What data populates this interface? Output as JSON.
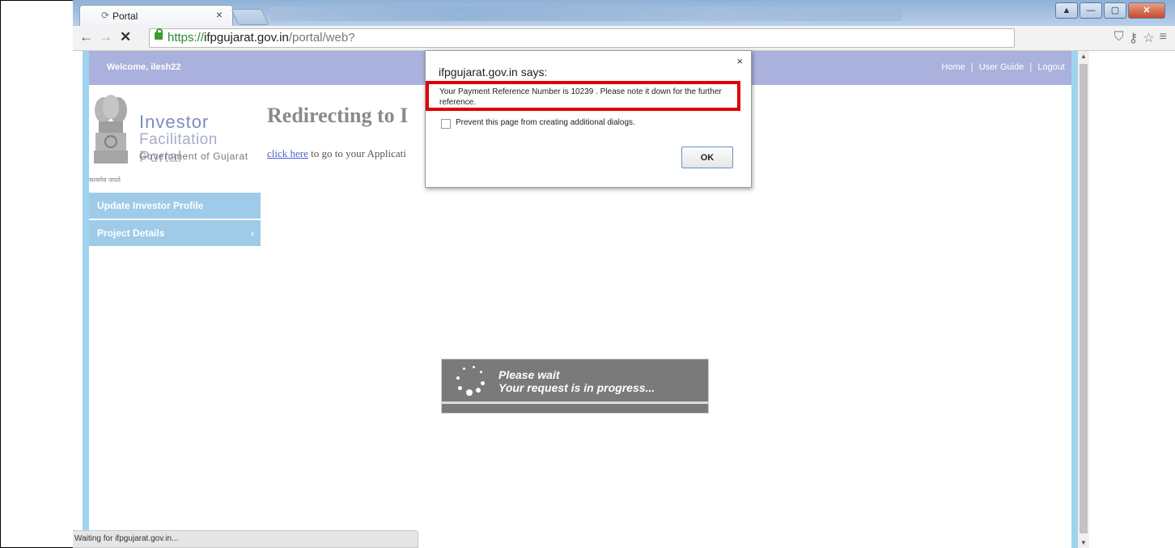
{
  "tab": {
    "title": "Portal",
    "close": "×"
  },
  "address": {
    "scheme": "https://",
    "host": "ifpgujarat.gov.in",
    "path": "/portal/web?"
  },
  "nav": {
    "back": "←",
    "forward": "→",
    "stop": "✕"
  },
  "toolbar_icons": [
    "shield-icon",
    "key-icon",
    "star-icon",
    "menu-icon"
  ],
  "window_buttons": [
    "minimize",
    "maximize",
    "close"
  ],
  "header": {
    "welcome": "Welcome, ilesh22",
    "links": [
      "Home",
      "User Guide",
      "Logout"
    ],
    "separator": "|"
  },
  "logo": {
    "line1": "Investor",
    "line2": "Facilitation Portal",
    "line3": "Government of Gujarat",
    "motto": "सत्यमेव जयते"
  },
  "sidebar": {
    "items": [
      {
        "label": "Update Investor Profile"
      },
      {
        "label": "Project Details",
        "arrow": "›"
      }
    ]
  },
  "main": {
    "title": "Redirecting to I",
    "link_text": "click here",
    "line_rest": " to go to your Applicati"
  },
  "dialog": {
    "title": "ifpgujarat.gov.in says:",
    "close": "×",
    "message": "Your Payment Reference Number is 10239 . Please note it down for the further reference.",
    "checkbox_label": "Prevent this page from creating additional dialogs.",
    "ok": "OK"
  },
  "loading": {
    "line1": "Please wait",
    "line2": "Your request is in progress..."
  },
  "status": {
    "text": "Waiting for ifpgujarat.gov.in..."
  },
  "colors": {
    "header_bar": "#aab1dc",
    "sidebar": "#9fcbe8",
    "highlight": "#e00000",
    "loading_bg": "#7a7a7a"
  }
}
